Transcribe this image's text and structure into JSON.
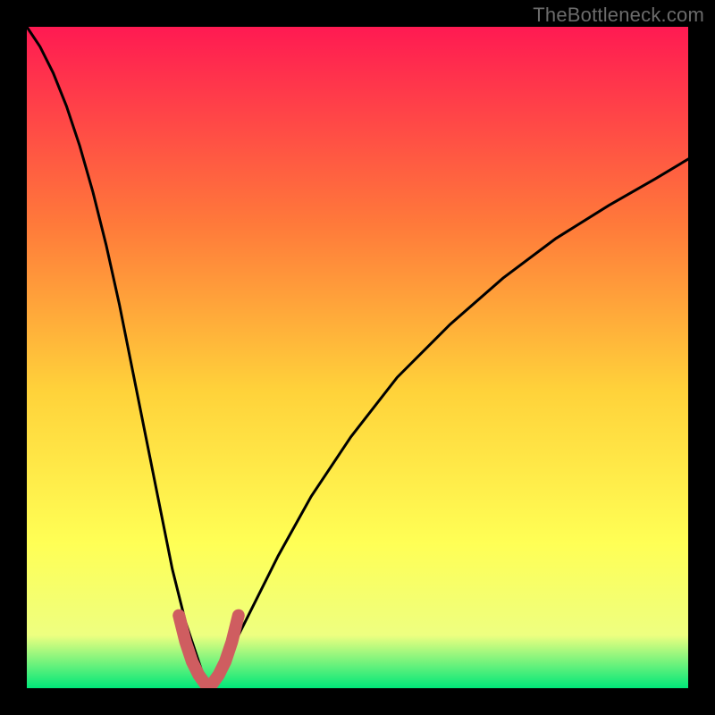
{
  "watermark": {
    "text": "TheBottleneck.com"
  },
  "colors": {
    "black": "#000000",
    "curve": "#000000",
    "marker": "#cf5d60",
    "grad_top": "#ff1a52",
    "grad_mid1": "#ff7a3a",
    "grad_mid2": "#ffd23a",
    "grad_mid3": "#ffff55",
    "grad_mid4": "#eeff80",
    "grad_bottom": "#00e779"
  },
  "chart_data": {
    "type": "line",
    "title": "",
    "xlabel": "",
    "ylabel": "",
    "xlim": [
      0,
      100
    ],
    "ylim": [
      0,
      100
    ],
    "series": [
      {
        "name": "bottleneck-curve-left",
        "x": [
          0,
          2,
          4,
          6,
          8,
          10,
          12,
          14,
          16,
          18,
          20,
          22,
          24,
          26,
          27,
          27.5
        ],
        "values": [
          100,
          97,
          93,
          88,
          82,
          75,
          67,
          58,
          48,
          38,
          28,
          18,
          10,
          4,
          1,
          0
        ]
      },
      {
        "name": "bottleneck-curve-right",
        "x": [
          27.5,
          29,
          31,
          34,
          38,
          43,
          49,
          56,
          64,
          72,
          80,
          88,
          95,
          100
        ],
        "values": [
          0,
          2,
          6,
          12,
          20,
          29,
          38,
          47,
          55,
          62,
          68,
          73,
          77,
          80
        ]
      },
      {
        "name": "optimal-marker",
        "x": [
          23,
          24,
          25,
          26,
          27,
          27.5,
          28,
          29,
          30,
          31,
          32
        ],
        "values": [
          11,
          7,
          4,
          2,
          0.6,
          0,
          0.6,
          2,
          4,
          7,
          11
        ]
      }
    ],
    "annotations": []
  }
}
